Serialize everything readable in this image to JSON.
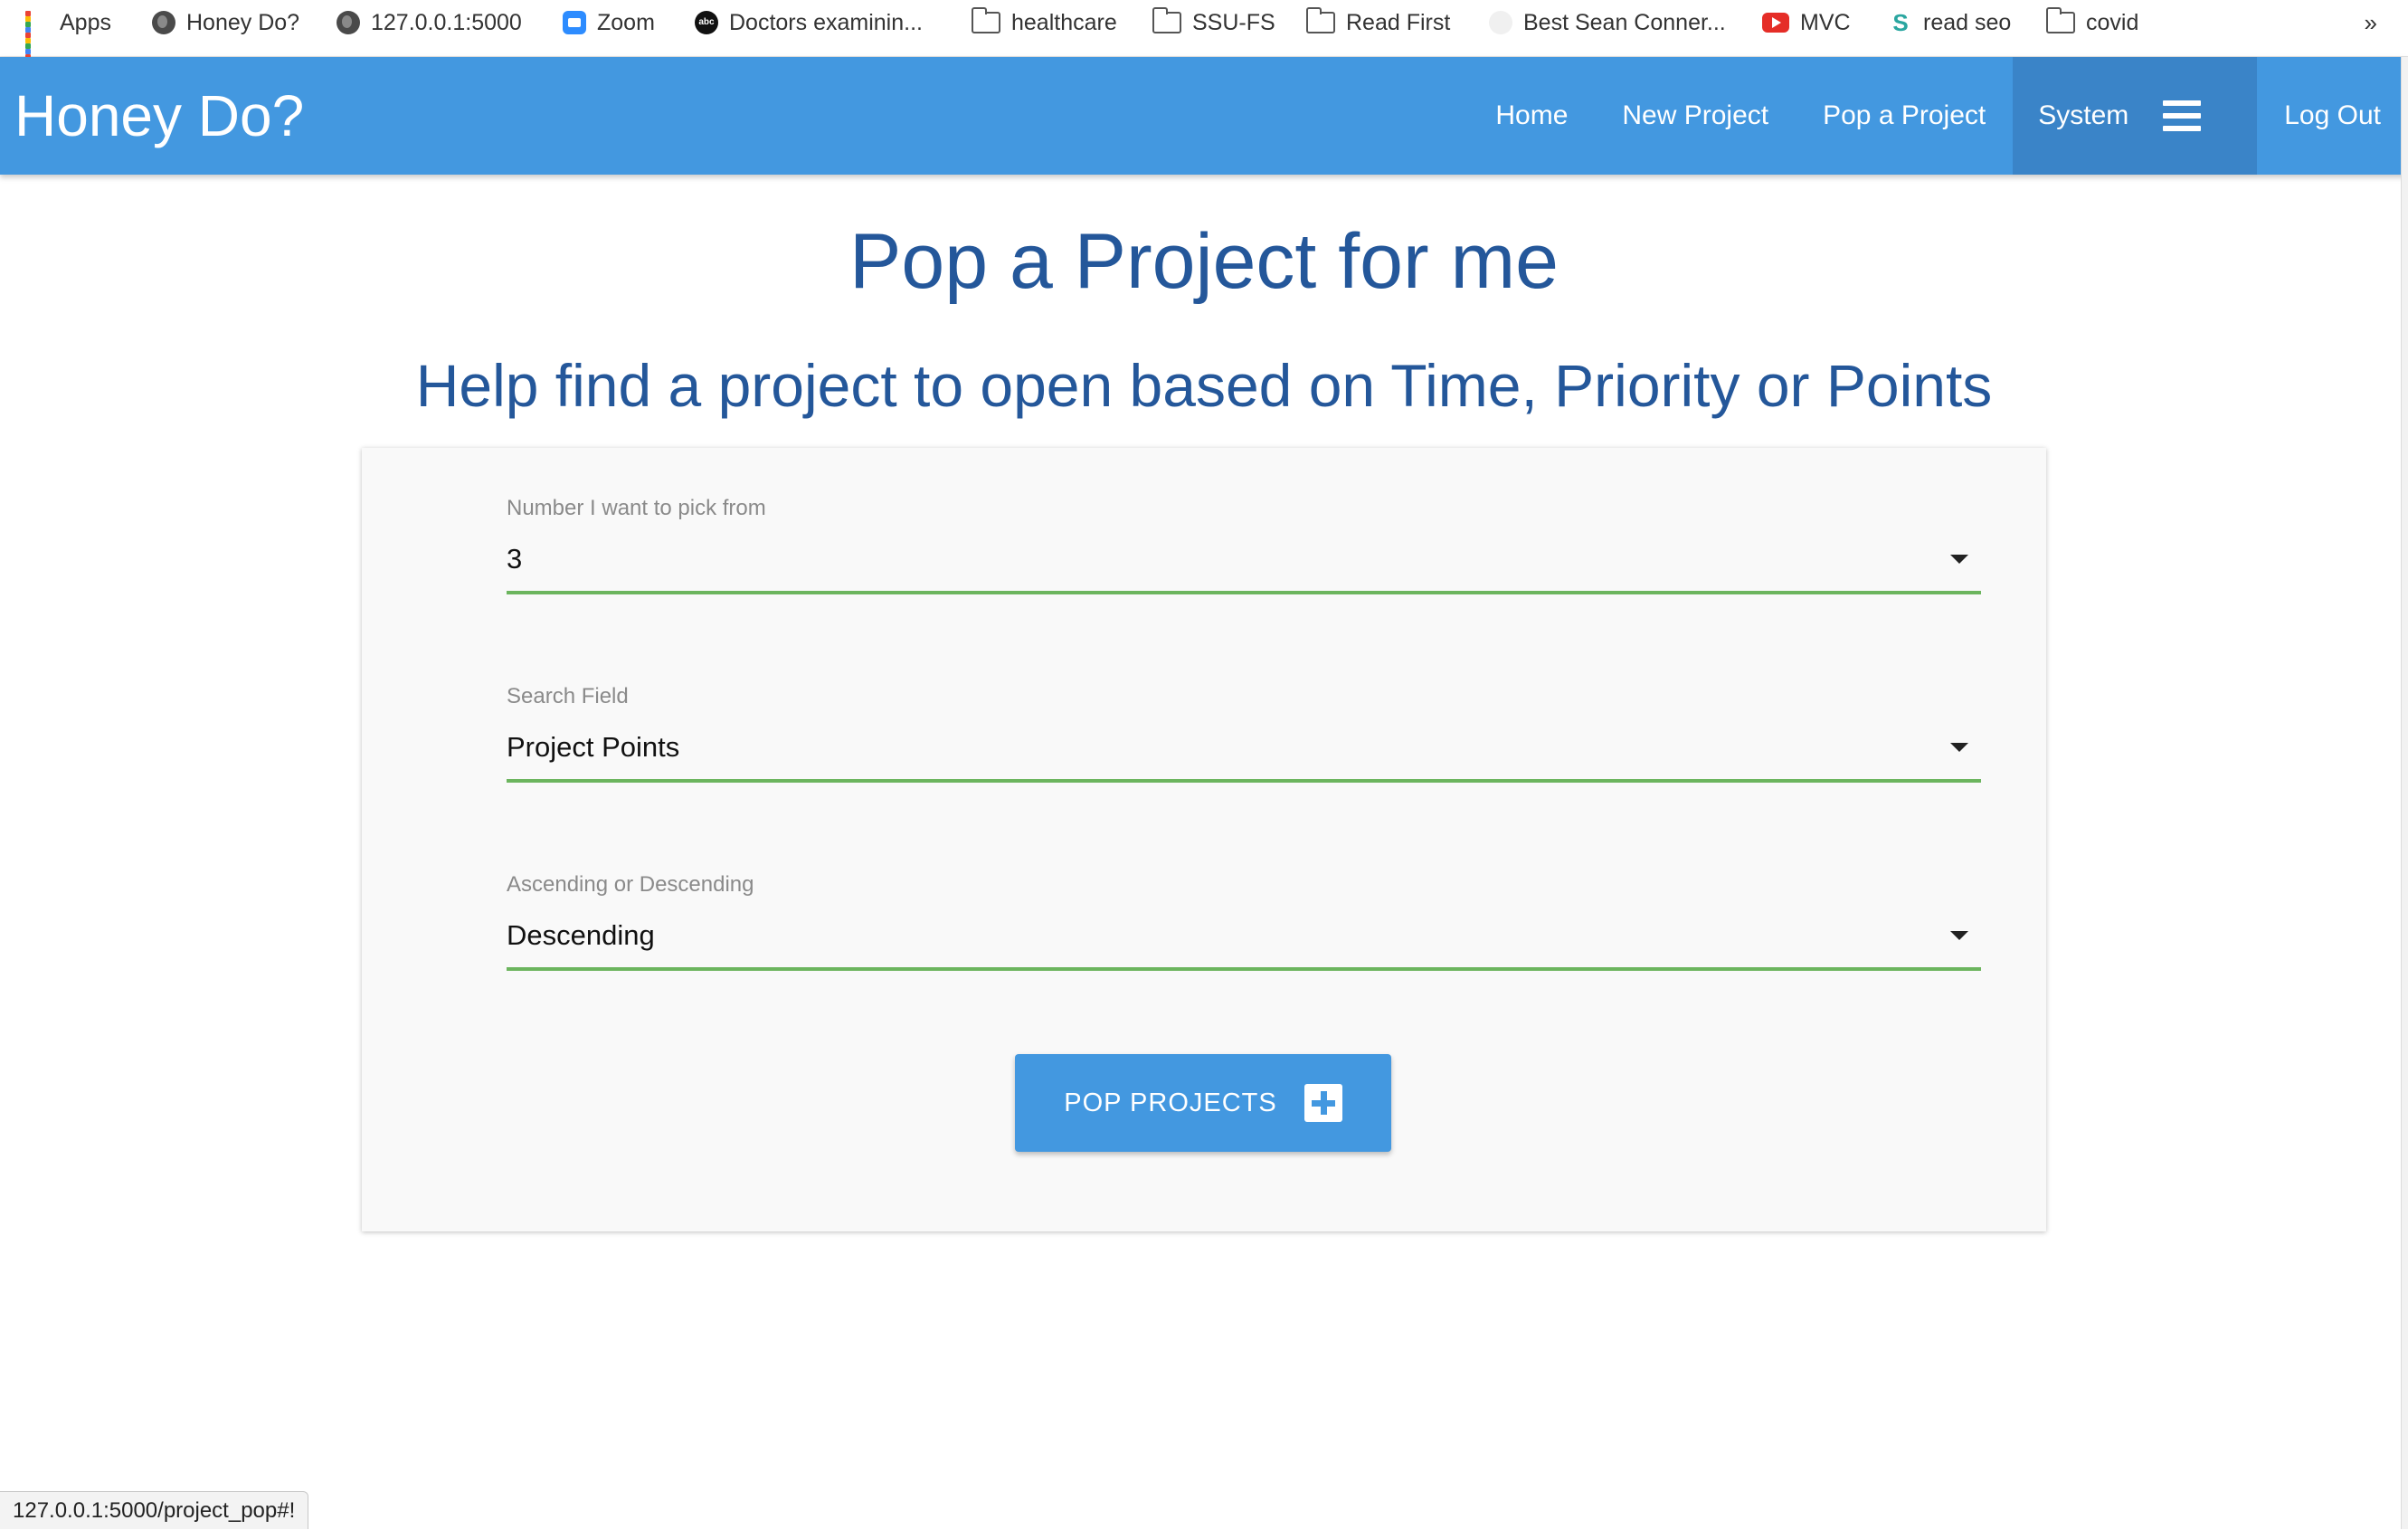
{
  "bookmarks": [
    {
      "label": "Apps",
      "icon": "apps-grid-icon"
    },
    {
      "label": "Honey Do?",
      "icon": "globe-icon"
    },
    {
      "label": "127.0.0.1:5000",
      "icon": "globe-icon"
    },
    {
      "label": "Zoom",
      "icon": "zoom-icon"
    },
    {
      "label": "Doctors examinin...",
      "icon": "abc-news-icon"
    },
    {
      "label": "healthcare",
      "icon": "folder-icon"
    },
    {
      "label": "SSU-FS",
      "icon": "folder-icon"
    },
    {
      "label": "Read First",
      "icon": "folder-icon"
    },
    {
      "label": "Best Sean Conner...",
      "icon": "nyt-icon"
    },
    {
      "label": "MVC",
      "icon": "youtube-icon"
    },
    {
      "label": "read seo",
      "icon": "s-icon"
    },
    {
      "label": "covid",
      "icon": "folder-icon"
    }
  ],
  "bookmarks_more": "»",
  "navbar": {
    "brand": "Honey Do?",
    "links": [
      "Home",
      "New Project",
      "Pop a Project"
    ],
    "system_label": "System",
    "logout_label": "Log Out",
    "background_color": "#4398e0"
  },
  "page": {
    "title": "Pop a Project for me",
    "subtitle": "Help find a project to open based on Time, Priority or Points",
    "title_color": "#24579a"
  },
  "form": {
    "number": {
      "label": "Number I want to pick from",
      "value": "3"
    },
    "search_field": {
      "label": "Search Field",
      "value": "Project Points"
    },
    "order": {
      "label": "Ascending or Descending",
      "value": "Descending"
    },
    "submit_label": "POP PROJECTS",
    "underline_color": "#6cb55e"
  },
  "status_bar": {
    "url": "127.0.0.1:5000/project_pop#!"
  }
}
